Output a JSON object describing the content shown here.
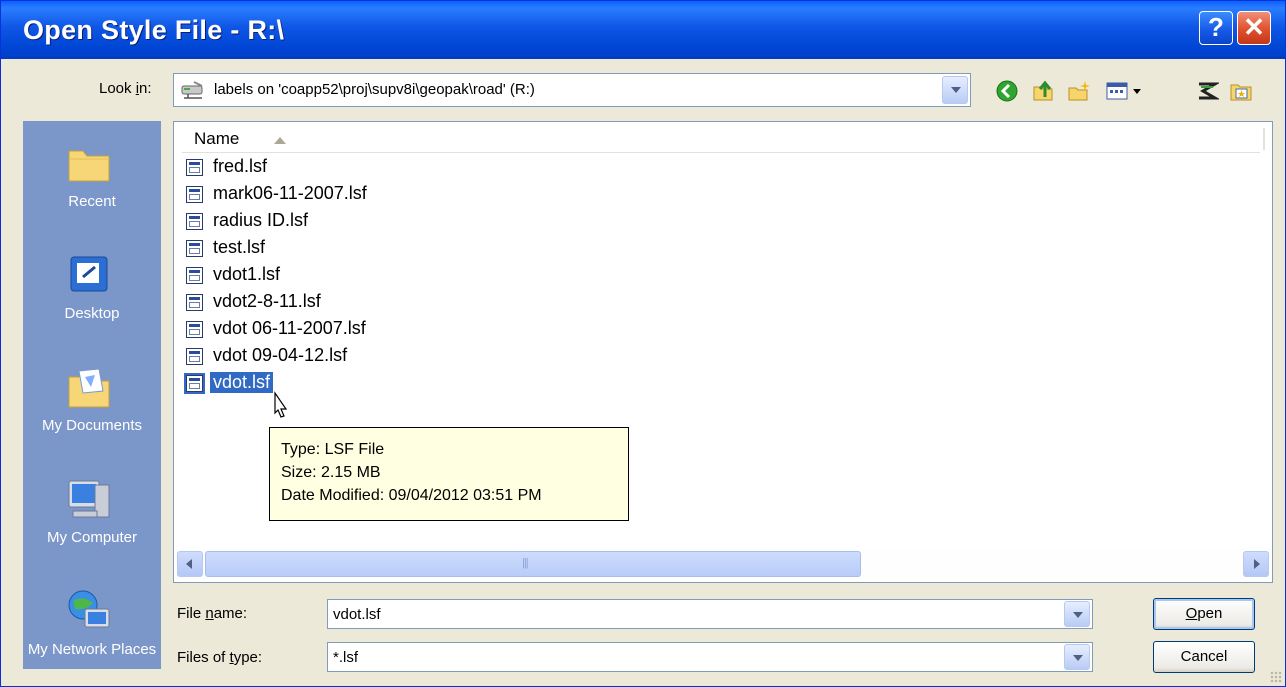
{
  "window": {
    "title": "Open Style File - R:\\",
    "help_icon": "help-icon",
    "close_icon": "close-icon"
  },
  "look_in": {
    "label_prefix": "Look ",
    "label_accel": "i",
    "label_suffix": "n:",
    "value": "labels on 'coapp52\\proj\\supv8i\\geopak\\road' (R:)",
    "icon": "network-drive-icon"
  },
  "toolbar": {
    "icons": [
      "back-icon",
      "up-folder-icon",
      "new-folder-icon",
      "views-menu-icon",
      "bentley-icon",
      "favorites-folder-icon"
    ]
  },
  "places": [
    {
      "label": "Recent",
      "icon": "recent-folder-icon"
    },
    {
      "label": "Desktop",
      "icon": "desktop-icon"
    },
    {
      "label": "My Documents",
      "icon": "my-documents-icon"
    },
    {
      "label": "My Computer",
      "icon": "my-computer-icon"
    },
    {
      "label": "My Network Places",
      "icon": "network-places-icon"
    }
  ],
  "file_list": {
    "column_header": "Name",
    "files": [
      {
        "name": "fred.lsf"
      },
      {
        "name": "mark06-11-2007.lsf"
      },
      {
        "name": "radius ID.lsf"
      },
      {
        "name": "test.lsf"
      },
      {
        "name": "vdot1.lsf"
      },
      {
        "name": "vdot2-8-11.lsf"
      },
      {
        "name": "vdot 06-11-2007.lsf"
      },
      {
        "name": "vdot 09-04-12.lsf"
      },
      {
        "name": "vdot.lsf"
      }
    ],
    "selected": "vdot.lsf"
  },
  "tooltip": {
    "type": "Type: LSF File",
    "size": "Size: 2.15 MB",
    "modified": "Date Modified: 09/04/2012 03:51 PM"
  },
  "file_name": {
    "label_prefix": "File ",
    "label_accel": "n",
    "label_suffix": "ame:",
    "value": "vdot.lsf"
  },
  "file_type": {
    "label_prefix": "Files of ",
    "label_accel": "t",
    "label_suffix": "ype:",
    "value": "*.lsf"
  },
  "buttons": {
    "open_accel": "O",
    "open_rest": "pen",
    "cancel": "Cancel"
  }
}
